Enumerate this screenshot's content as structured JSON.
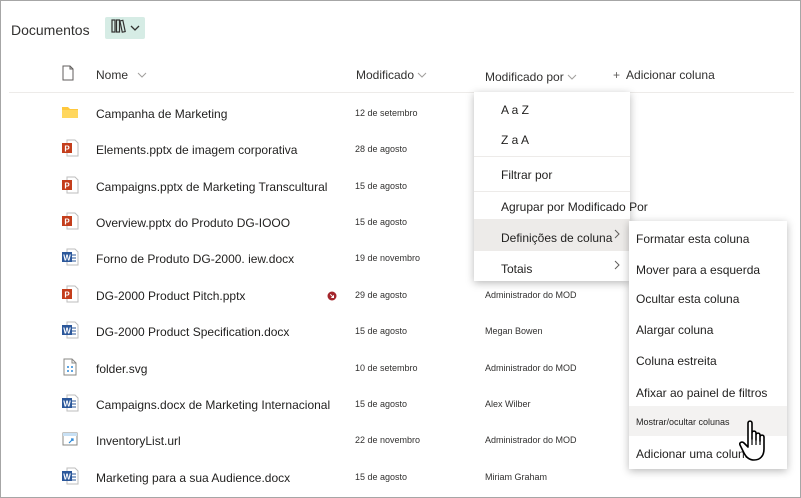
{
  "library": {
    "title": "Documentos"
  },
  "columns": {
    "name": "Nome",
    "modified": "Modificado",
    "modified_by": "Modificado por",
    "add_column": "Adicionar coluna"
  },
  "rows": [
    {
      "icon": "folder-icon",
      "name": "Campanha de Marketing",
      "date": "12 de setembro",
      "by": ""
    },
    {
      "icon": "powerpoint-icon",
      "name": "Elements.pptx de imagem corporativa",
      "date": "28 de agosto",
      "by": ""
    },
    {
      "icon": "powerpoint-icon",
      "name": "Campaigns.pptx de Marketing Transcultural",
      "date": "15 de agosto",
      "by": ""
    },
    {
      "icon": "powerpoint-icon",
      "name": "Overview.pptx do Produto DG-IOOO",
      "date": "15 de agosto",
      "by": ""
    },
    {
      "icon": "word-icon",
      "name": "Forno de Produto DG-2000. iew.docx",
      "date": "19 de novembro",
      "by": ""
    },
    {
      "icon": "powerpoint-icon",
      "name": "DG-2000 Product Pitch.pptx",
      "date": "29 de agosto",
      "by": "Administrador do MOD"
    },
    {
      "icon": "word-icon",
      "name": "DG-2000 Product Specification.docx",
      "date": "15 de agosto",
      "by": "Megan Bowen"
    },
    {
      "icon": "svg-file-icon",
      "name": "folder.svg",
      "date": "10 de setembro",
      "by": "Administrador do MOD"
    },
    {
      "icon": "word-icon",
      "name": "Campaigns.docx de Marketing Internacional",
      "date": "15 de agosto",
      "by": "Alex Wilber"
    },
    {
      "icon": "url-file-icon",
      "name": "InventoryList.url",
      "date": "22 de novembro",
      "by": "Administrador do MOD"
    },
    {
      "icon": "word-icon",
      "name": "Marketing para a sua Audience.docx",
      "date": "15 de agosto",
      "by": "Miriam Graham"
    }
  ],
  "column_menu": {
    "items": [
      "A a Z",
      "Z a A",
      "Filtrar por",
      "Agrupar por Modificado Por",
      "Definições de coluna",
      "Totais"
    ]
  },
  "settings_submenu": {
    "items": [
      "Formatar esta coluna",
      "Mover para a esquerda",
      "Ocultar esta coluna",
      "Alargar coluna",
      "Coluna estreita",
      "Afixar ao painel de filtros",
      "Mostrar/ocultar colunas",
      "Adicionar uma coluna"
    ]
  },
  "colors": {
    "accent_view_button": "#d6ece5",
    "powerpoint": "#c43e1c",
    "word": "#2b579a",
    "folder": "#ffc83d",
    "alert": "#a4262c"
  }
}
